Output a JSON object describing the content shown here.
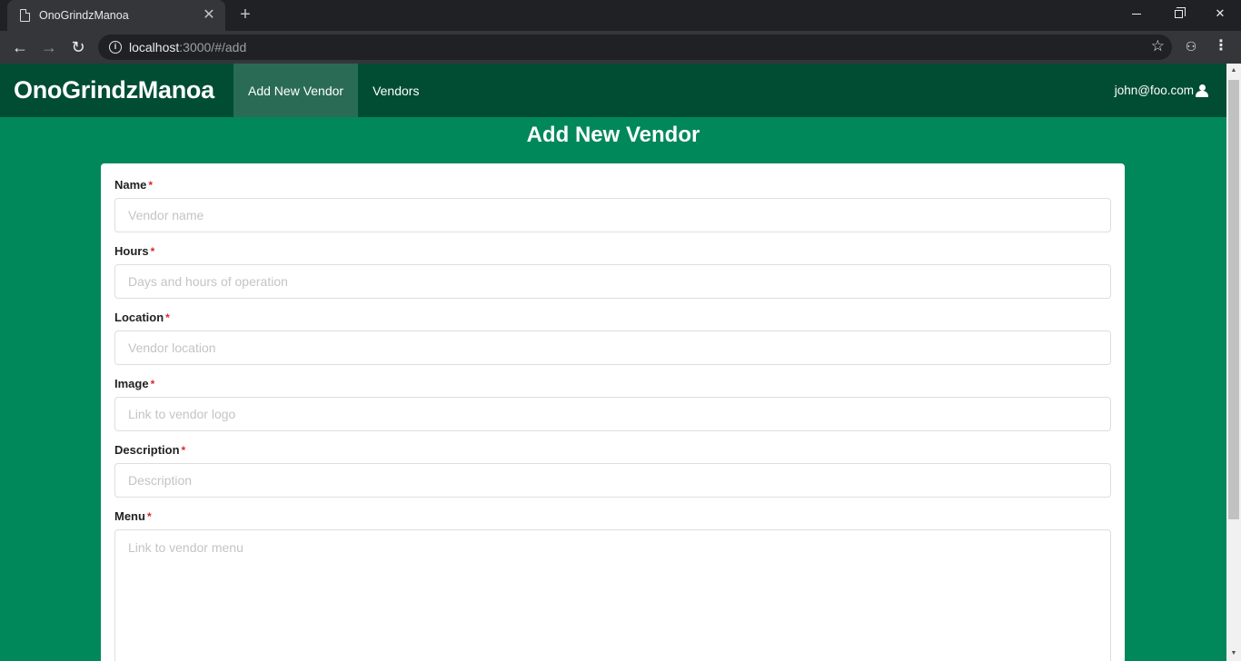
{
  "browser": {
    "tab_title": "OnoGrindzManoa",
    "url_host": "localhost",
    "url_rest": ":3000/#/add"
  },
  "icons": {
    "tab": "page-icon",
    "close": "close-icon",
    "new_tab": "plus-icon",
    "back": "back-arrow-icon",
    "forward": "forward-arrow-icon",
    "reload": "reload-icon",
    "info": "info-icon",
    "star": "star-icon",
    "incognito": "incognito-icon",
    "menu": "kebab-menu-icon",
    "user": "user-icon"
  },
  "colors": {
    "page_background": "#00885a",
    "navbar": "#014d33",
    "active_nav": "#2a6b55",
    "required": "#db2828"
  },
  "navbar": {
    "brand": "OnoGrindzManoa",
    "items": [
      {
        "label": "Add New Vendor",
        "active": true
      },
      {
        "label": "Vendors",
        "active": false
      }
    ],
    "user": "john@foo.com"
  },
  "page": {
    "title": "Add New Vendor"
  },
  "form": {
    "fields": [
      {
        "label": "Name",
        "required_mark": "*",
        "value": "",
        "placeholder": "Vendor name"
      },
      {
        "label": "Hours",
        "required_mark": "*",
        "value": "",
        "placeholder": "Days and hours of operation"
      },
      {
        "label": "Location",
        "required_mark": "*",
        "value": "",
        "placeholder": "Vendor location"
      },
      {
        "label": "Image",
        "required_mark": "*",
        "value": "",
        "placeholder": "Link to vendor logo"
      },
      {
        "label": "Description",
        "required_mark": "*",
        "value": "",
        "placeholder": "Description"
      },
      {
        "label": "Menu",
        "required_mark": "*",
        "value": "",
        "placeholder": "Link to vendor menu"
      }
    ]
  }
}
